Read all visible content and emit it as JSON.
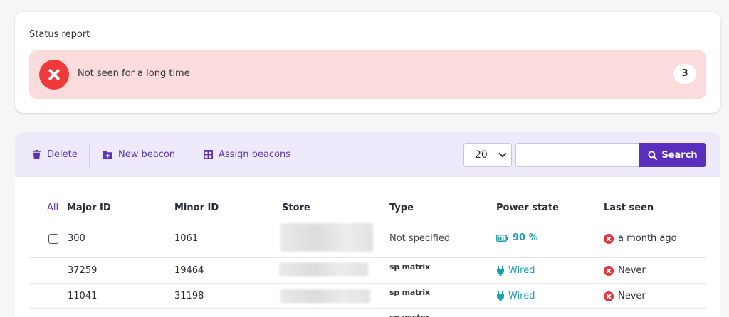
{
  "status": {
    "title": "Status report",
    "alert_text": "Not seen for a long time",
    "alert_count": "3"
  },
  "toolbar": {
    "delete_label": "Delete",
    "new_beacon_label": "New beacon",
    "assign_label": "Assign beacons",
    "page_size": "20",
    "search_label": "Search",
    "search_value": ""
  },
  "table": {
    "all_label": "All",
    "headers": [
      "Major ID",
      "Minor ID",
      "Store",
      "Type",
      "Power state",
      "Last seen"
    ],
    "rows": [
      {
        "major": "300",
        "minor": "1061",
        "type": "Not specified",
        "power": "90 %",
        "power_kind": "battery",
        "last_seen": "a month ago"
      },
      {
        "major": "37259",
        "minor": "19464",
        "type": "sp matrix",
        "power": "Wired",
        "power_kind": "wired",
        "last_seen": "Never"
      },
      {
        "major": "11041",
        "minor": "31198",
        "type": "sp matrix",
        "power": "Wired",
        "power_kind": "wired",
        "last_seen": "Never"
      },
      {
        "type": "sp vector"
      }
    ]
  },
  "colors": {
    "accent": "#5b2fbd",
    "alert_bg": "#fadcdc",
    "alert_icon": "#f03a3a",
    "power": "#1f9eb1",
    "toolbar_bg": "#efeafb"
  },
  "icons": {
    "delete": "trash-icon",
    "new_beacon": "folder-plus-icon",
    "assign": "grid-icon",
    "search": "magnifier-icon",
    "battery": "battery-icon",
    "wired": "plug-icon",
    "status_error": "x-circle-icon"
  }
}
